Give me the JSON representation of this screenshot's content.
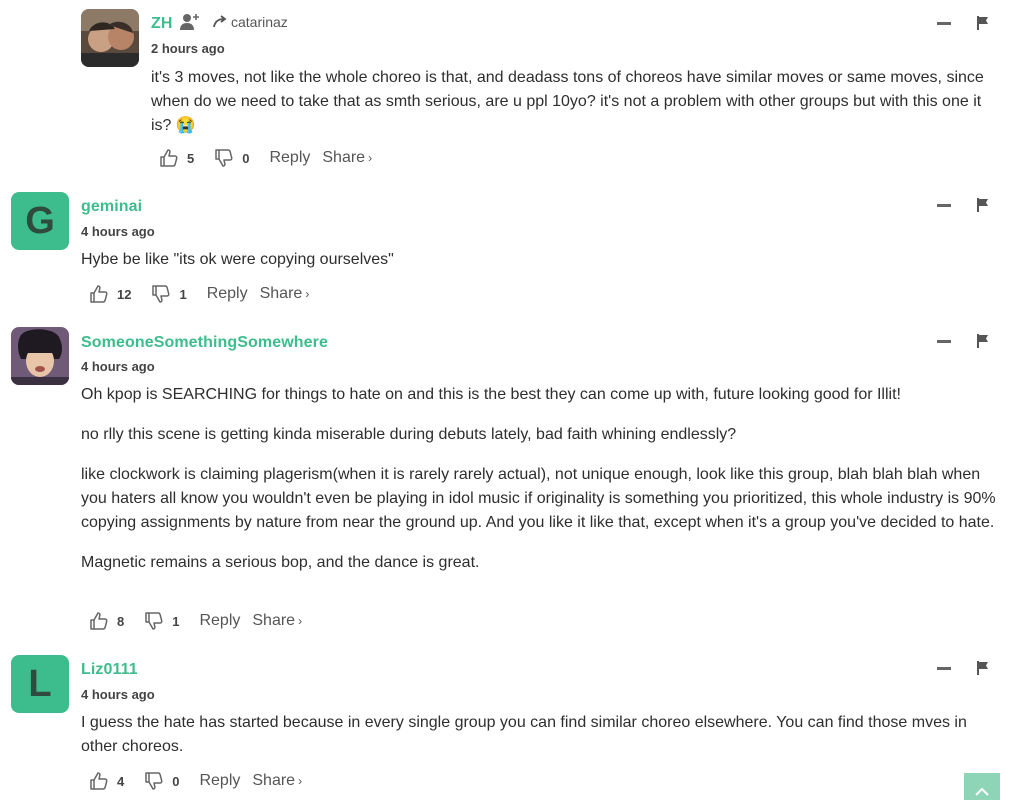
{
  "actions_labels": {
    "reply": "Reply",
    "share": "Share",
    "share_chevron": "›"
  },
  "colors": {
    "accent": "#3dbd8e",
    "avatar_bg": "#3dbd8e",
    "scroll_top_bg": "#8ed4b6"
  },
  "comments": [
    {
      "author": "ZH",
      "reply_to": "catarinaz",
      "time": "2 hours ago",
      "paragraphs": [
        "it's 3 moves, not like the whole choreo is that, and deadass tons of choreos have similar moves or same moves, since when do we need to take that as smth serious, are u ppl 10yo? it's not a problem with other groups but with this one it is? 😭"
      ],
      "likes": "5",
      "dislikes": "0"
    },
    {
      "author": "geminai",
      "avatar_letter": "G",
      "time": "4 hours ago",
      "paragraphs": [
        "Hybe be like \"its ok were copying ourselves\""
      ],
      "likes": "12",
      "dislikes": "1"
    },
    {
      "author": "SomeoneSomethingSomewhere",
      "time": "4 hours ago",
      "paragraphs": [
        "Oh kpop is SEARCHING for things to hate on and this is the best they can come up with, future looking good for Illit!",
        "no rlly this scene is getting kinda miserable during debuts lately, bad faith whining endlessly?",
        "like clockwork is claiming plagerism(when it is rarely rarely actual), not unique enough, look like this group, blah blah blah when you haters all know you wouldn't even be playing in idol music if originality is something you prioritized, this whole industry is 90% copying assignments by nature from near the ground up. And you like it like that, except when it's a group you've decided to hate.",
        "Magnetic remains a serious bop, and the dance is great."
      ],
      "likes": "8",
      "dislikes": "1"
    },
    {
      "author": "Liz0111",
      "avatar_letter": "L",
      "time": "4 hours ago",
      "paragraphs": [
        "I guess the hate has started because in every single group you can find similar choreo elsewhere. You can find those mves in other choreos."
      ],
      "likes": "4",
      "dislikes": "0"
    }
  ]
}
